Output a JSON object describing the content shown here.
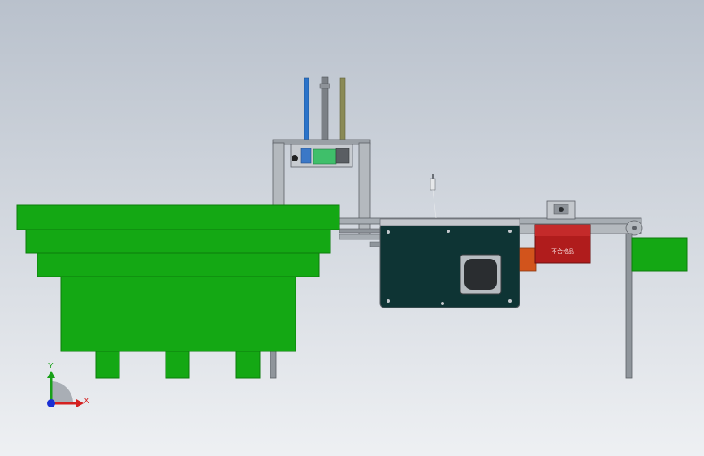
{
  "viewport": {
    "background_top": "#b9c1cc",
    "background_bottom": "#eef0f3"
  },
  "colors": {
    "feeder_green": "#14a814",
    "feeder_green_dark": "#0b7d0b",
    "frame_gray": "#9aa0a6",
    "frame_dark": "#5c6066",
    "motor_box": "#0e3434",
    "red_panel": "#b01c1c",
    "orange_part": "#d2541c",
    "rod_blue": "#2b73c9",
    "rod_gray": "#7b8086",
    "rod_olive": "#8a8a55",
    "axis_x": "#d42020",
    "axis_y": "#18a018",
    "axis_z": "#1a2fd4"
  },
  "triad": {
    "x_label": "X",
    "y_label": "Y"
  },
  "red_panel": {
    "label": "不合格品"
  },
  "icons": {
    "triad": "coordinate-triad-icon"
  }
}
